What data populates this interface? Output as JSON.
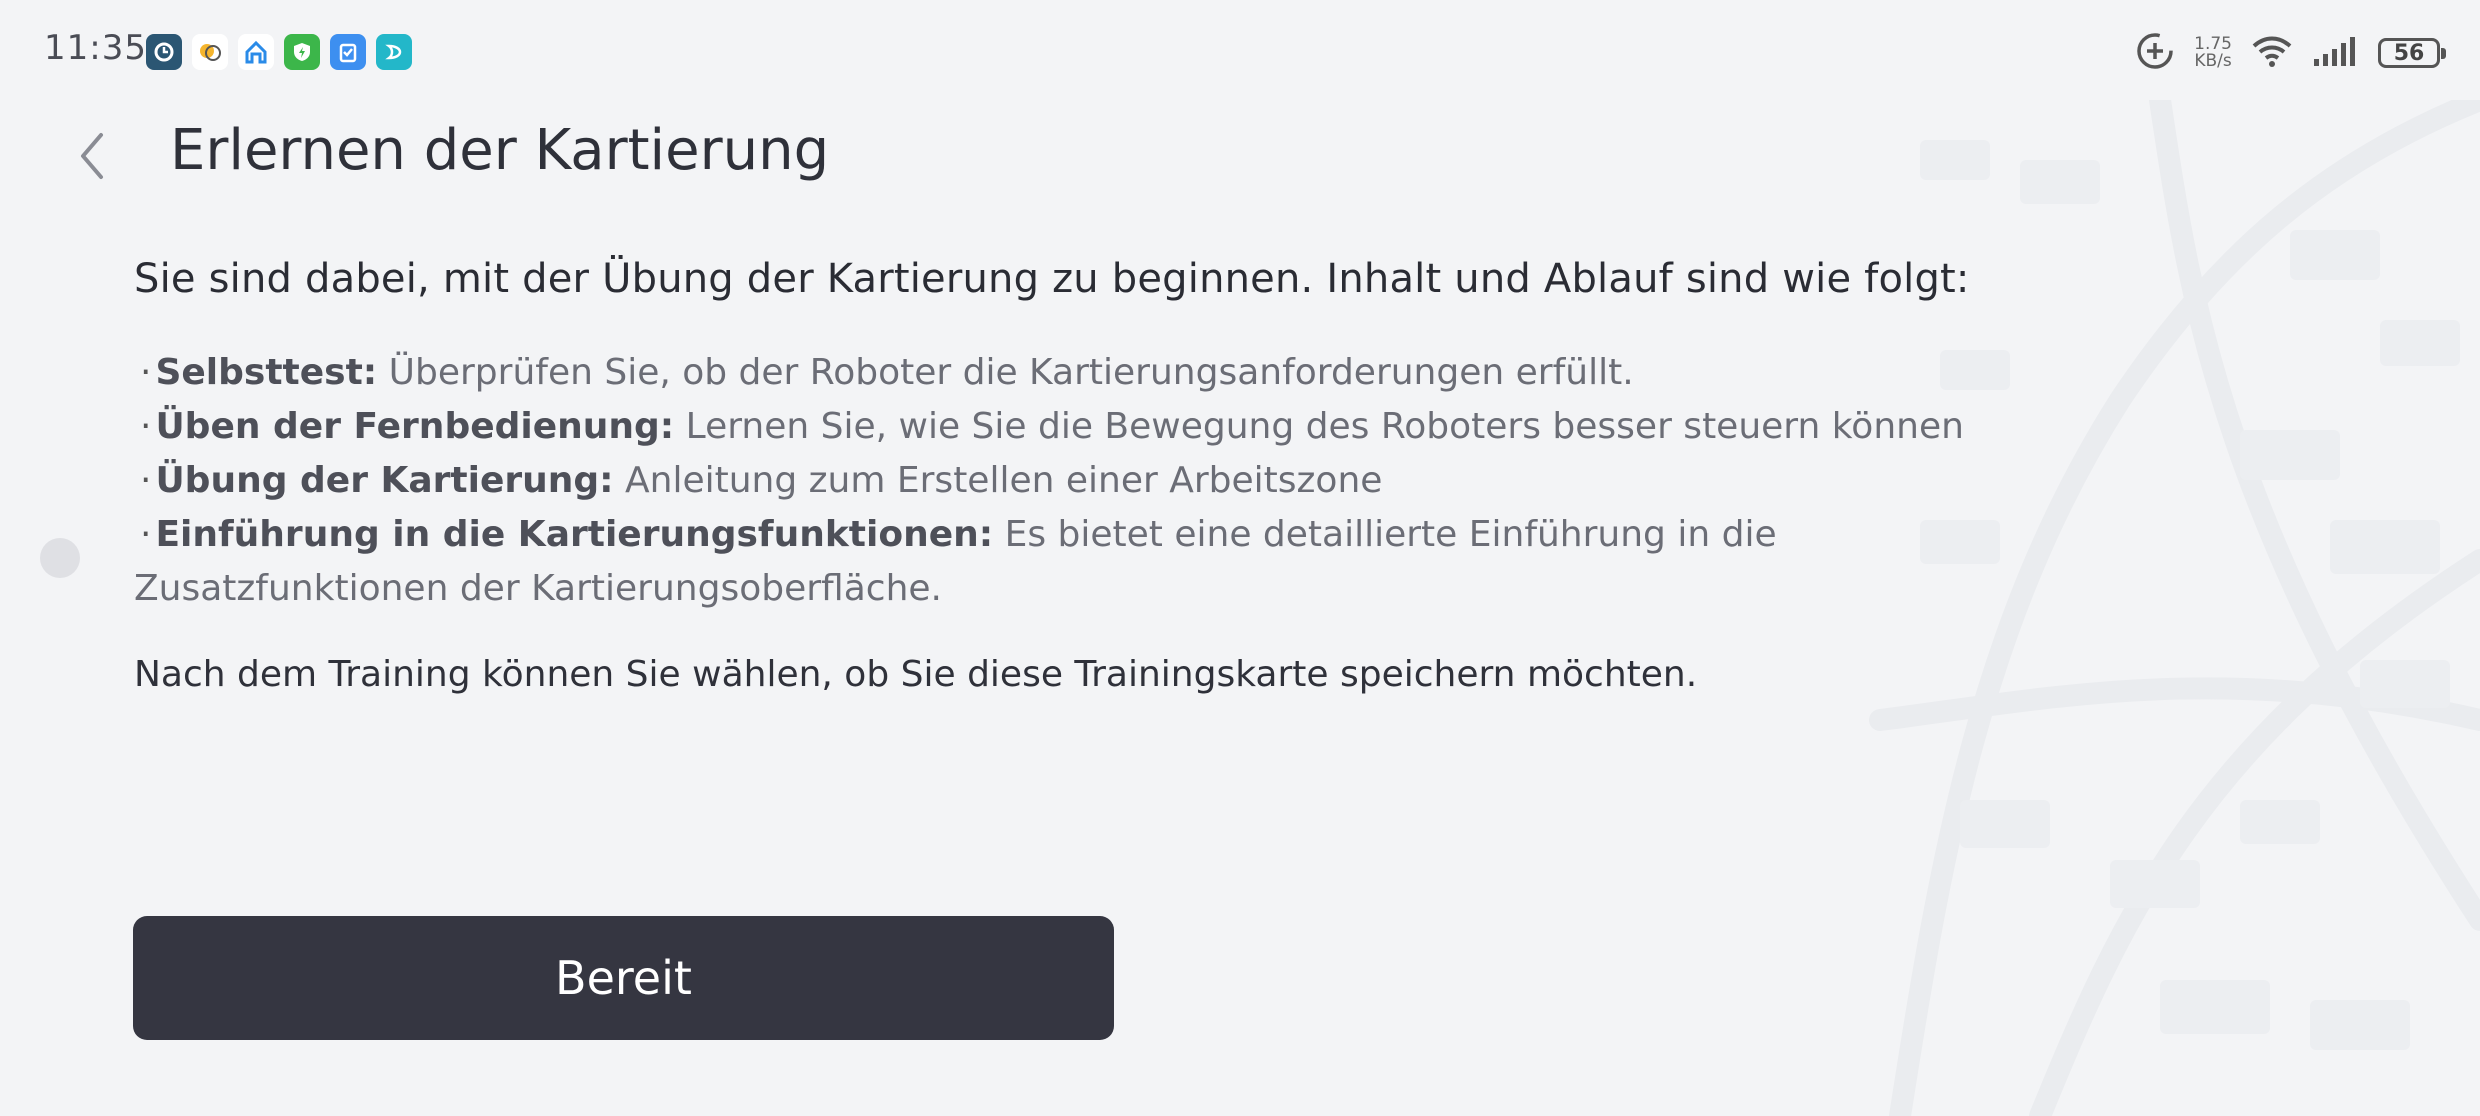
{
  "status_bar": {
    "time": "11:35",
    "net_speed_value": "1.75",
    "net_speed_unit": "KB/s",
    "battery_level": "56",
    "notification_icons": [
      "clock-app-icon",
      "weather-app-icon",
      "home-app-icon",
      "security-app-icon",
      "clipboard-app-icon",
      "assistant-app-icon"
    ]
  },
  "header": {
    "title": "Erlernen der Kartierung"
  },
  "content": {
    "intro": "Sie sind dabei, mit der Übung der Kartierung zu beginnen. Inhalt und Ablauf sind wie folgt:",
    "items": [
      {
        "term": "Selbsttest:",
        "text": " Überprüfen Sie, ob der Roboter die Kartierungsanforderungen erfüllt."
      },
      {
        "term": "Üben der Fernbedienung:",
        "text": " Lernen Sie, wie Sie die Bewegung des Roboters besser steuern können"
      },
      {
        "term": "Übung der Kartierung:",
        "text": " Anleitung zum Erstellen einer Arbeitszone"
      },
      {
        "term": "Einführung in die Kartierungsfunktionen:",
        "text": " Es bietet eine detaillierte Einführung in die Zusatzfunktionen der Kartierungsoberfläche."
      }
    ],
    "outro": "Nach dem Training können Sie wählen, ob Sie diese Trainingskarte speichern möchten."
  },
  "actions": {
    "ready_label": "Bereit"
  },
  "colors": {
    "background": "#f3f4f6",
    "button": "#353641",
    "title_text": "#2f313a",
    "muted_text": "#6b6d76"
  }
}
